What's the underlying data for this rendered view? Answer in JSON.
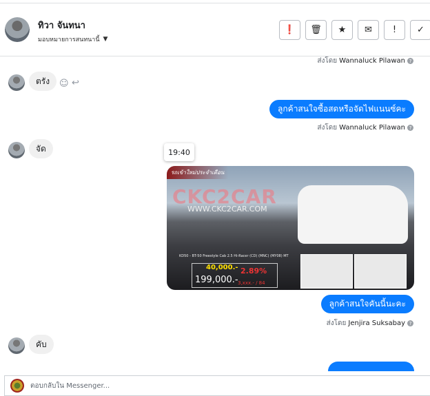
{
  "header": {
    "name": "ทิวา จันทนา",
    "assign_label": "มอบหมายการสนทนานี้",
    "actions": [
      {
        "name": "spam",
        "glyph": "❗"
      },
      {
        "name": "delete",
        "glyph": "🗑"
      },
      {
        "name": "star",
        "glyph": "★"
      },
      {
        "name": "mark-unread",
        "glyph": "✉"
      },
      {
        "name": "follow-up",
        "glyph": "!"
      },
      {
        "name": "done",
        "glyph": "✓"
      }
    ]
  },
  "messages": {
    "sender_prefix": "ส่งโดย",
    "s0": "Wannaluck Pilawan",
    "m1": "ตรัง",
    "m2": "ลูกค้าสนใจซื้อสดหรือจัดไฟแนนซ์คะ",
    "s2": "Wannaluck Pilawan",
    "m3": "จัด",
    "tooltip": "19:40",
    "image": {
      "ribbon": "รถเข้าใหม่ประจำเดือน",
      "brand": "CKC2CAR",
      "url": "WWW.CKC2CAR.COM",
      "model": "KD50 - BT-50 Freestyle Cab 2.5 Hi-Racer (CD) (MNC) (MY08) MT",
      "down": "40,000.-",
      "price": "199,000.-",
      "rate": "2.89%",
      "installment": "3,xxx.- / 84"
    },
    "m4": "ลูกค้าสนใจคันนี้นะคะ",
    "s4": "Jenjira Suksabay",
    "m5": "คับ"
  },
  "composer": {
    "placeholder": "ตอบกลับใน Messenger..."
  }
}
